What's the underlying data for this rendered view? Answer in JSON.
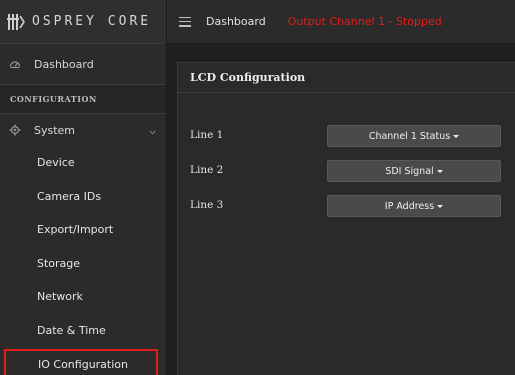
{
  "brand": {
    "name": "OSPREY CORE",
    "logo_icon": "osprey-logo-icon"
  },
  "sidebar": {
    "dashboard_label": "Dashboard",
    "dashboard_icon": "gauge-icon",
    "section_heading": "CONFIGURATION",
    "system_label": "System",
    "system_icon": "gear-icon",
    "sub_items": {
      "device": "Device",
      "camera_ids": "Camera IDs",
      "export_import": "Export/Import",
      "storage": "Storage",
      "network": "Network",
      "date_time": "Date & Time",
      "io_configuration": "IO Configuration"
    },
    "active_highlight_color": "#e01e1e"
  },
  "topbar": {
    "menu_icon": "hamburger-icon",
    "breadcrumb": "Dashboard",
    "status": "Output Channel 1 - Stopped",
    "status_color": "#e51a1a"
  },
  "lcd": {
    "title": "LCD Configuration",
    "lines": [
      {
        "label": "Line 1",
        "value": "Channel 1 Status"
      },
      {
        "label": "Line 2",
        "value": "SDI Signal"
      },
      {
        "label": "Line 3",
        "value": "IP Address"
      }
    ]
  }
}
